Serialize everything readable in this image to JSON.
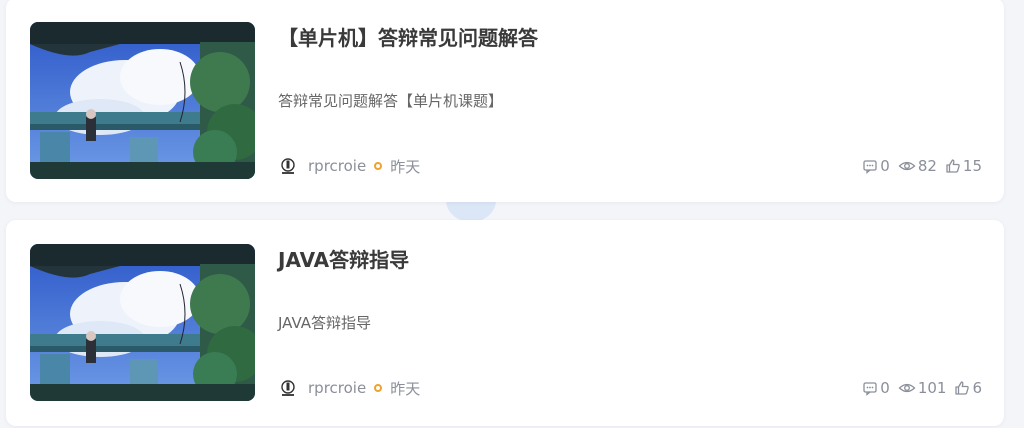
{
  "posts": [
    {
      "title": "【单片机】答辩常见问题解答",
      "description": "答辩常见问题解答【单片机课题】",
      "author": "rprcroie",
      "time": "昨天",
      "comments": "0",
      "views": "82",
      "likes": "15"
    },
    {
      "title": "JAVA答辩指导",
      "description": "JAVA答辩指导",
      "author": "rprcroie",
      "time": "昨天",
      "comments": "0",
      "views": "101",
      "likes": "6"
    }
  ],
  "icons": {
    "comment": "comment-icon",
    "view": "eye-icon",
    "like": "thumbs-up-icon",
    "time_marker": "circle-dot-icon"
  },
  "colors": {
    "accent_dot": "#f0a22c",
    "meta_text": "#8a8f99",
    "title_text": "#3a3a3a"
  }
}
